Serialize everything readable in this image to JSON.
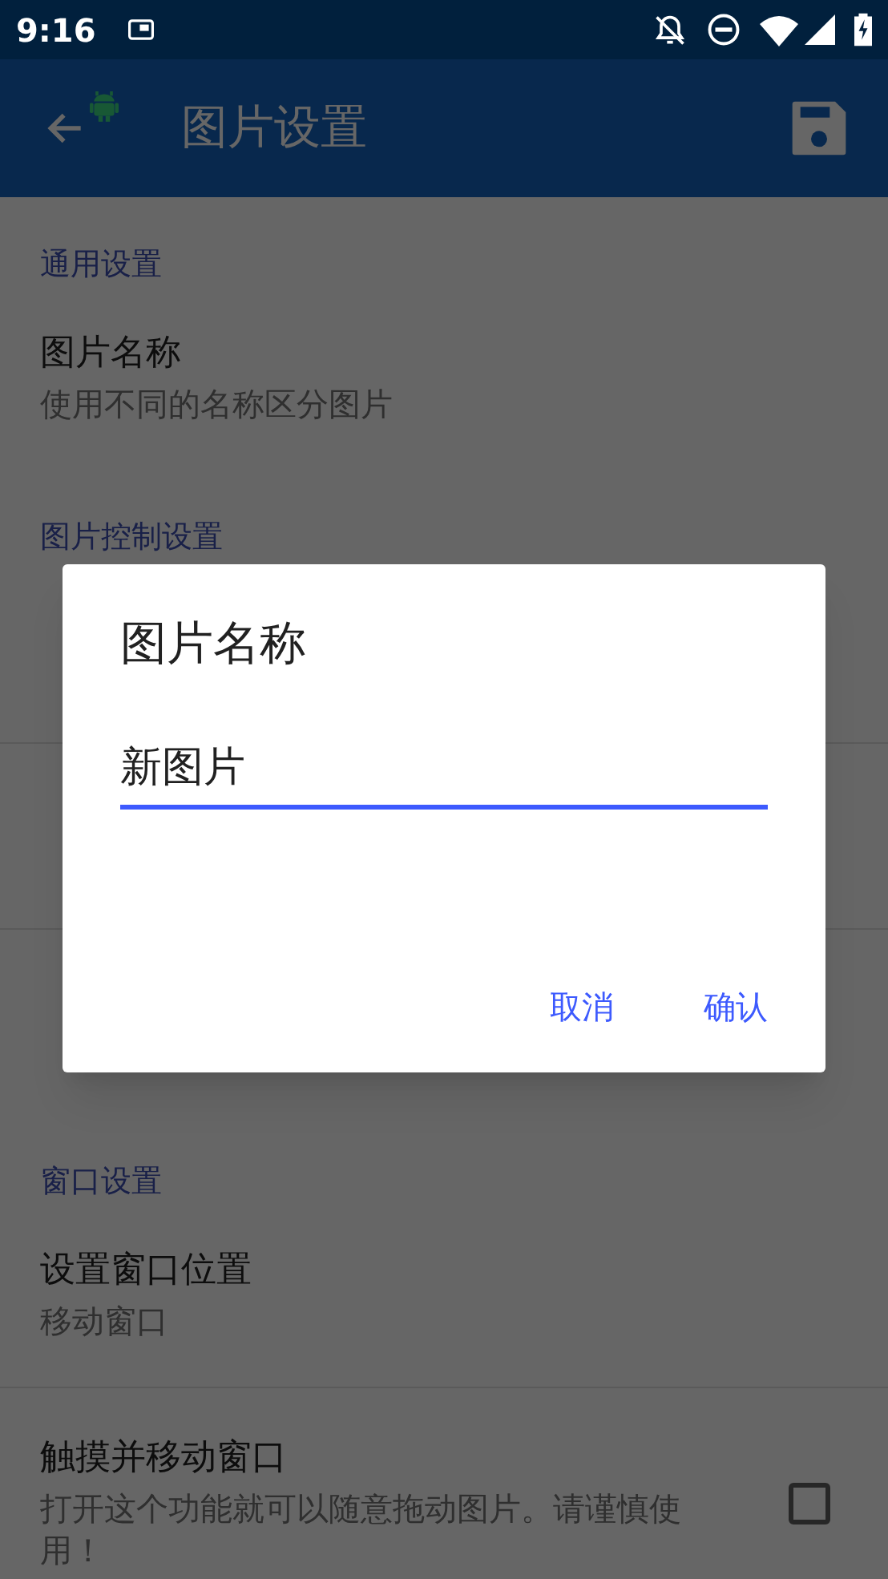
{
  "status_bar": {
    "time": "9:16"
  },
  "app_bar": {
    "title": "图片设置"
  },
  "sections": [
    {
      "header": "通用设置",
      "items": [
        {
          "kind": "text",
          "title": "图片名称",
          "summary": "使用不同的名称区分图片"
        }
      ]
    },
    {
      "header": "图片控制设置",
      "items": [
        {
          "kind": "covered"
        },
        {
          "kind": "covered"
        },
        {
          "kind": "covered"
        }
      ]
    },
    {
      "header": "窗口设置",
      "items": [
        {
          "kind": "text",
          "title": "设置窗口位置",
          "summary": "移动窗口"
        },
        {
          "kind": "checkbox",
          "title": "触摸并移动窗口",
          "summary": "打开这个功能就可以随意拖动图片。请谨慎使用！",
          "checked": false
        }
      ]
    }
  ],
  "dialog": {
    "title": "图片名称",
    "value": "新图片",
    "buttons": [
      "取消",
      "确认"
    ]
  }
}
